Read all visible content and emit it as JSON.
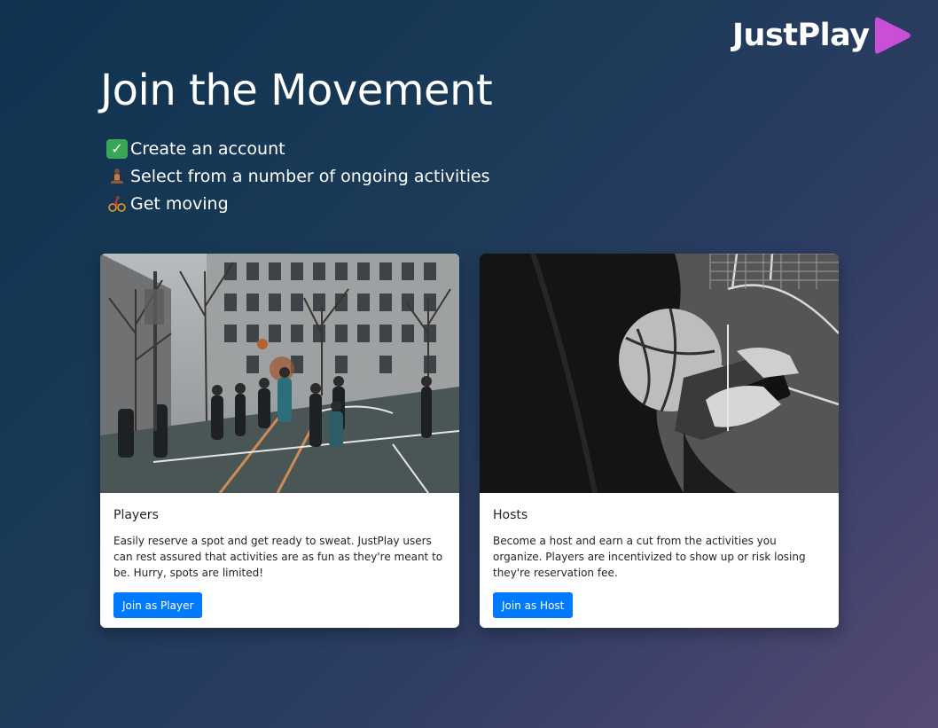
{
  "brand": {
    "name": "JustPlay",
    "accent_color": "#c94fd6",
    "logo_icon": "play-triangle-icon"
  },
  "hero": {
    "title": "Join the Movement",
    "steps": [
      {
        "icon": "check-mark-emoji-icon",
        "text": "Create an account"
      },
      {
        "icon": "person-in-lotus-position-emoji-icon",
        "text": "Select from a number of ongoing activities"
      },
      {
        "icon": "person-biking-emoji-icon",
        "text": "Get moving"
      }
    ]
  },
  "cards": [
    {
      "image": "outdoor-basketball-court-photo",
      "title": "Players",
      "text": "Easily reserve a spot and get ready to sweat. JustPlay users can rest assured that activities are as fun as they're meant to be. Hurry, spots are limited!",
      "button_label": "Join as Player"
    },
    {
      "image": "person-holding-basketball-and-phone-photo",
      "title": "Hosts",
      "text": "Become a host and earn a cut from the activities you organize. Players are incentivized to show up or risk losing they're reservation fee.",
      "button_label": "Join as Host"
    }
  ],
  "colors": {
    "button": "#007bff",
    "card_background": "#ffffff",
    "text_dark": "#212529"
  }
}
